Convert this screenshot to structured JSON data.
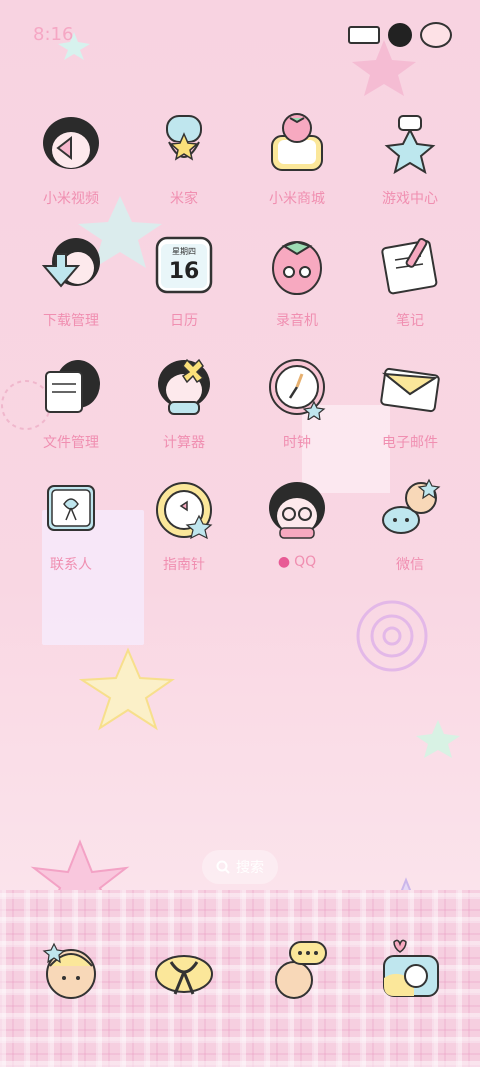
{
  "status_bar": {
    "time": "8:16"
  },
  "apps": [
    {
      "label": "小米视频",
      "icon": "video-girl-icon"
    },
    {
      "label": "米家",
      "icon": "mijia-icon"
    },
    {
      "label": "小米商城",
      "icon": "strawberry-shop-icon"
    },
    {
      "label": "游戏中心",
      "icon": "game-center-icon"
    },
    {
      "label": "下载管理",
      "icon": "download-girl-icon"
    },
    {
      "label": "日历",
      "icon": "calendar-icon",
      "calendar_weekday": "星期四",
      "calendar_day": "16"
    },
    {
      "label": "录音机",
      "icon": "recorder-strawberry-icon"
    },
    {
      "label": "笔记",
      "icon": "notes-icon"
    },
    {
      "label": "文件管理",
      "icon": "file-manager-icon"
    },
    {
      "label": "计算器",
      "icon": "calculator-girl-icon"
    },
    {
      "label": "时钟",
      "icon": "clock-icon"
    },
    {
      "label": "电子邮件",
      "icon": "email-icon"
    },
    {
      "label": "联系人",
      "icon": "contacts-icon"
    },
    {
      "label": "指南针",
      "icon": "compass-icon"
    },
    {
      "label": "QQ",
      "icon": "qq-girl-icon",
      "has_dot": true
    },
    {
      "label": "微信",
      "icon": "wechat-icon"
    }
  ],
  "search": {
    "label": "搜索",
    "icon": "search-icon"
  },
  "dock": [
    {
      "icon": "phone-character-icon"
    },
    {
      "icon": "messages-ribbon-icon"
    },
    {
      "icon": "browser-character-icon"
    },
    {
      "icon": "camera-icon"
    }
  ],
  "colors": {
    "label": "#f08fb1",
    "background": "#f8d3e1",
    "dot": "#e85a95"
  }
}
